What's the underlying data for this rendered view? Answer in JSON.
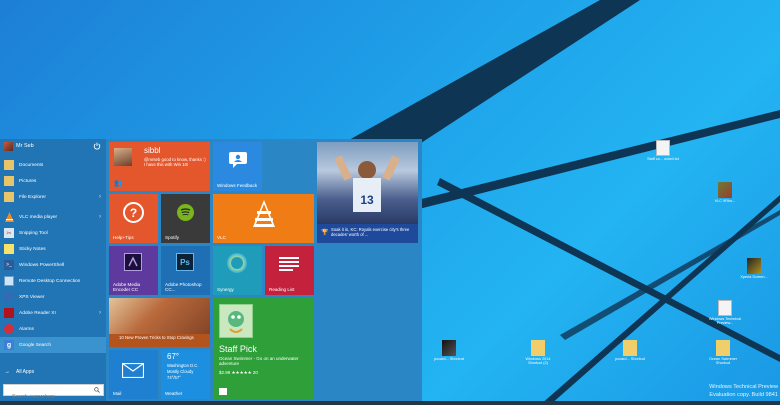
{
  "start_menu": {
    "user": {
      "name": "Mr Seb"
    },
    "apps": [
      {
        "label": "Documents",
        "icon": "folder-icon",
        "chevron": false
      },
      {
        "label": "Pictures",
        "icon": "folder-icon",
        "chevron": false
      },
      {
        "label": "File Explorer",
        "icon": "folder-icon",
        "chevron": true
      },
      {
        "label": "VLC media player",
        "icon": "vlc-icon",
        "chevron": true
      },
      {
        "label": "Snipping Tool",
        "icon": "scissors-icon",
        "chevron": false
      },
      {
        "label": "Sticky Notes",
        "icon": "note-icon",
        "chevron": false
      },
      {
        "label": "Windows PowerShell",
        "icon": "powershell-icon",
        "chevron": false
      },
      {
        "label": "Remote Desktop Connection",
        "icon": "monitor-icon",
        "chevron": false
      },
      {
        "label": "XPS Viewer",
        "icon": "document-icon",
        "chevron": false
      },
      {
        "label": "Adobe Reader XI",
        "icon": "pdf-icon",
        "chevron": true
      },
      {
        "label": "Alarms",
        "icon": "alarm-icon",
        "chevron": false
      },
      {
        "label": "Google Search",
        "icon": "google-icon",
        "chevron": false
      }
    ],
    "all_apps_label": "All Apps",
    "search_placeholder": "Search everywhere"
  },
  "tiles": {
    "people": {
      "name": "sibbl",
      "message": "@mrseb good to know, thanks :) I have this with Win 10!"
    },
    "feedback": {
      "label": "Windows Feedback"
    },
    "news": {
      "caption": "Soak it in, KC: Royals exercise city's three decades' worth of ..."
    },
    "help": {
      "label": "Help+Tips"
    },
    "spotify": {
      "label": "Spotify"
    },
    "vlc": {
      "label": "VLC"
    },
    "media_encoder": {
      "label": "Adobe Media Encoder CC"
    },
    "photoshop": {
      "label": "Adobe Photoshop CC..."
    },
    "synergy": {
      "label": "Synergy"
    },
    "reading_list": {
      "label": "Reading List"
    },
    "food": {
      "label": "10 New Proven Tricks to Stop Cravings"
    },
    "store": {
      "title": "Staff Pick",
      "app": "Ocean Swimmer - Go on an underwater adventure",
      "price": "$2.99 ★★★★★ 20"
    },
    "mail": {
      "label": "Mail"
    },
    "weather": {
      "temp": "67°",
      "location": "Washington D.C.",
      "condition": "Mostly Cloudy",
      "range": "74°/57°",
      "label": "Weather"
    }
  },
  "desktop_icons": [
    {
      "label": "Staff co... w4w4.txt",
      "glyph": "text-file-icon"
    },
    {
      "label": "VLC 9Rho...",
      "glyph": "image-file-icon"
    },
    {
      "label": "Xperia Screen...",
      "glyph": "shortcut-icon"
    },
    {
      "label": "Windows Technical Preview...",
      "glyph": "text-file-icon"
    },
    {
      "label": "pccard... Shortcut",
      "glyph": "shortcut-icon"
    },
    {
      "label": "Windows 2014 Shortcut (2)",
      "glyph": "folder-shortcut-icon"
    },
    {
      "label": "pccard... Shortcut",
      "glyph": "folder-shortcut-icon"
    },
    {
      "label": "Ocean Swimmer Shortcut",
      "glyph": "folder-shortcut-icon"
    }
  ],
  "watermark": {
    "line1": "Windows Technical Preview",
    "line2": "Evaluation copy. Build 9841"
  },
  "colors": {
    "start_bg": "#2a86c4",
    "left_bg": "#2175b4",
    "tile_orange": "#e4562b",
    "tile_blue": "#2b8ae0",
    "tile_purple": "#5f3a9e",
    "tile_green": "#2e9f39",
    "tile_red": "#c4213c",
    "tile_teal": "#1f9cba"
  }
}
